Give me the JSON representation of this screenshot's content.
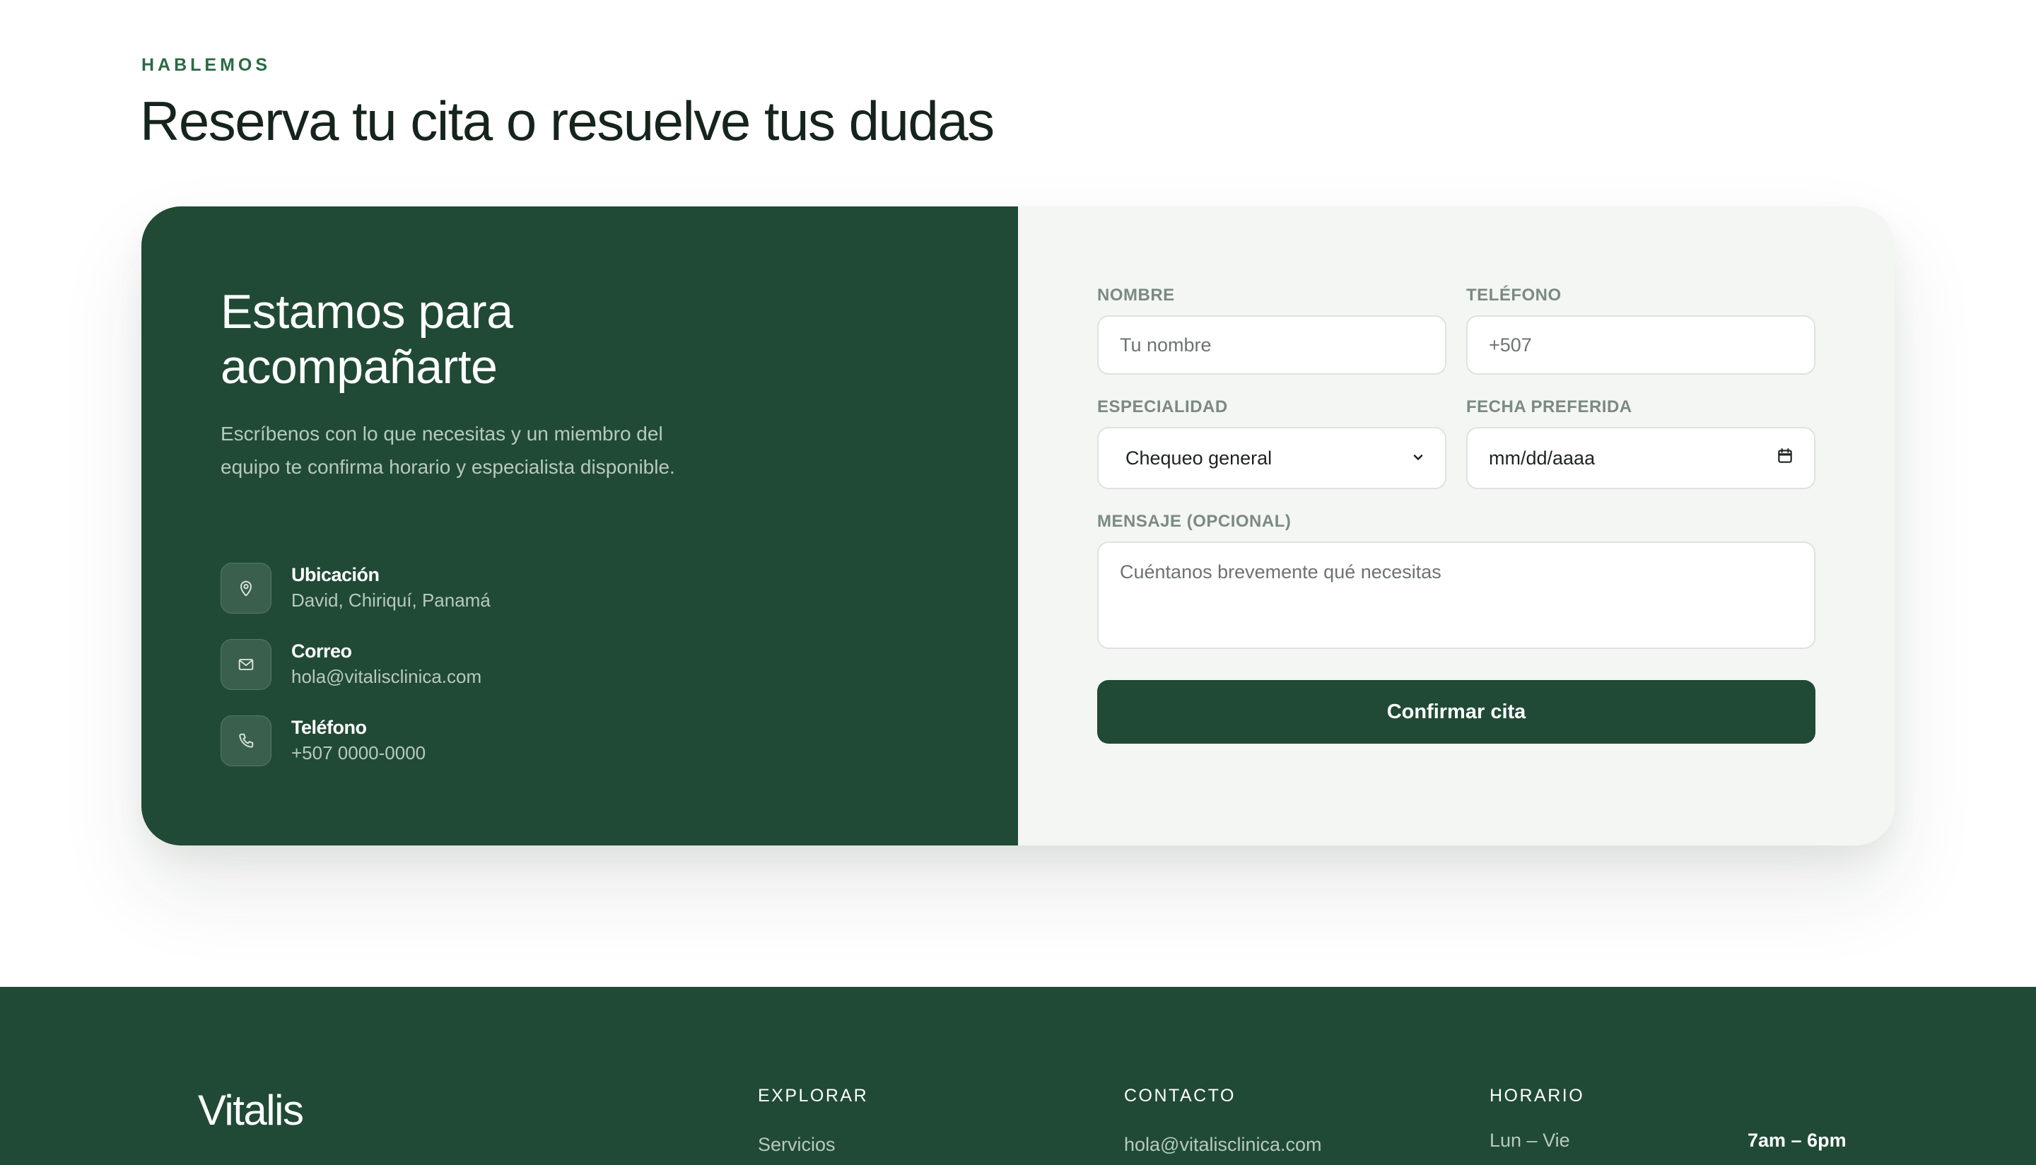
{
  "section": {
    "eyebrow": "HABLEMOS",
    "title": "Reserva tu cita o resuelve tus dudas"
  },
  "card": {
    "title_line1": "Estamos para",
    "title_line2": "acompañarte",
    "description": "Escríbenos con lo que necesitas y un miembro del equipo te confirma horario y especialista disponible.",
    "info": [
      {
        "label": "Ubicación",
        "value": "David, Chiriquí, Panamá",
        "icon": "map-pin-icon"
      },
      {
        "label": "Correo",
        "value": "hola@vitalisclinica.com",
        "icon": "mail-icon"
      },
      {
        "label": "Teléfono",
        "value": "+507 0000-0000",
        "icon": "phone-icon"
      }
    ]
  },
  "form": {
    "name_label": "NOMBRE",
    "name_placeholder": "Tu nombre",
    "phone_label": "TELÉFONO",
    "phone_placeholder": "+507",
    "specialty_label": "ESPECIALIDAD",
    "specialty_value": "Chequeo general",
    "date_label": "FECHA PREFERIDA",
    "date_placeholder": "mm/dd/aaaa",
    "message_label": "MENSAJE (OPCIONAL)",
    "message_placeholder": "Cuéntanos brevemente qué necesitas",
    "submit_label": "Confirmar cita"
  },
  "footer": {
    "brand": "Vitalis",
    "explore_heading": "EXPLORAR",
    "explore_first": "Servicios",
    "contact_heading": "CONTACTO",
    "contact_email": "hola@vitalisclinica.com",
    "hours_heading": "HORARIO",
    "hours_days": "Lun – Vie",
    "hours_time": "7am – 6pm"
  },
  "colors": {
    "brand_green": "#204a35",
    "accent_green": "#2a6a44",
    "form_bg": "#f4f6f3"
  }
}
